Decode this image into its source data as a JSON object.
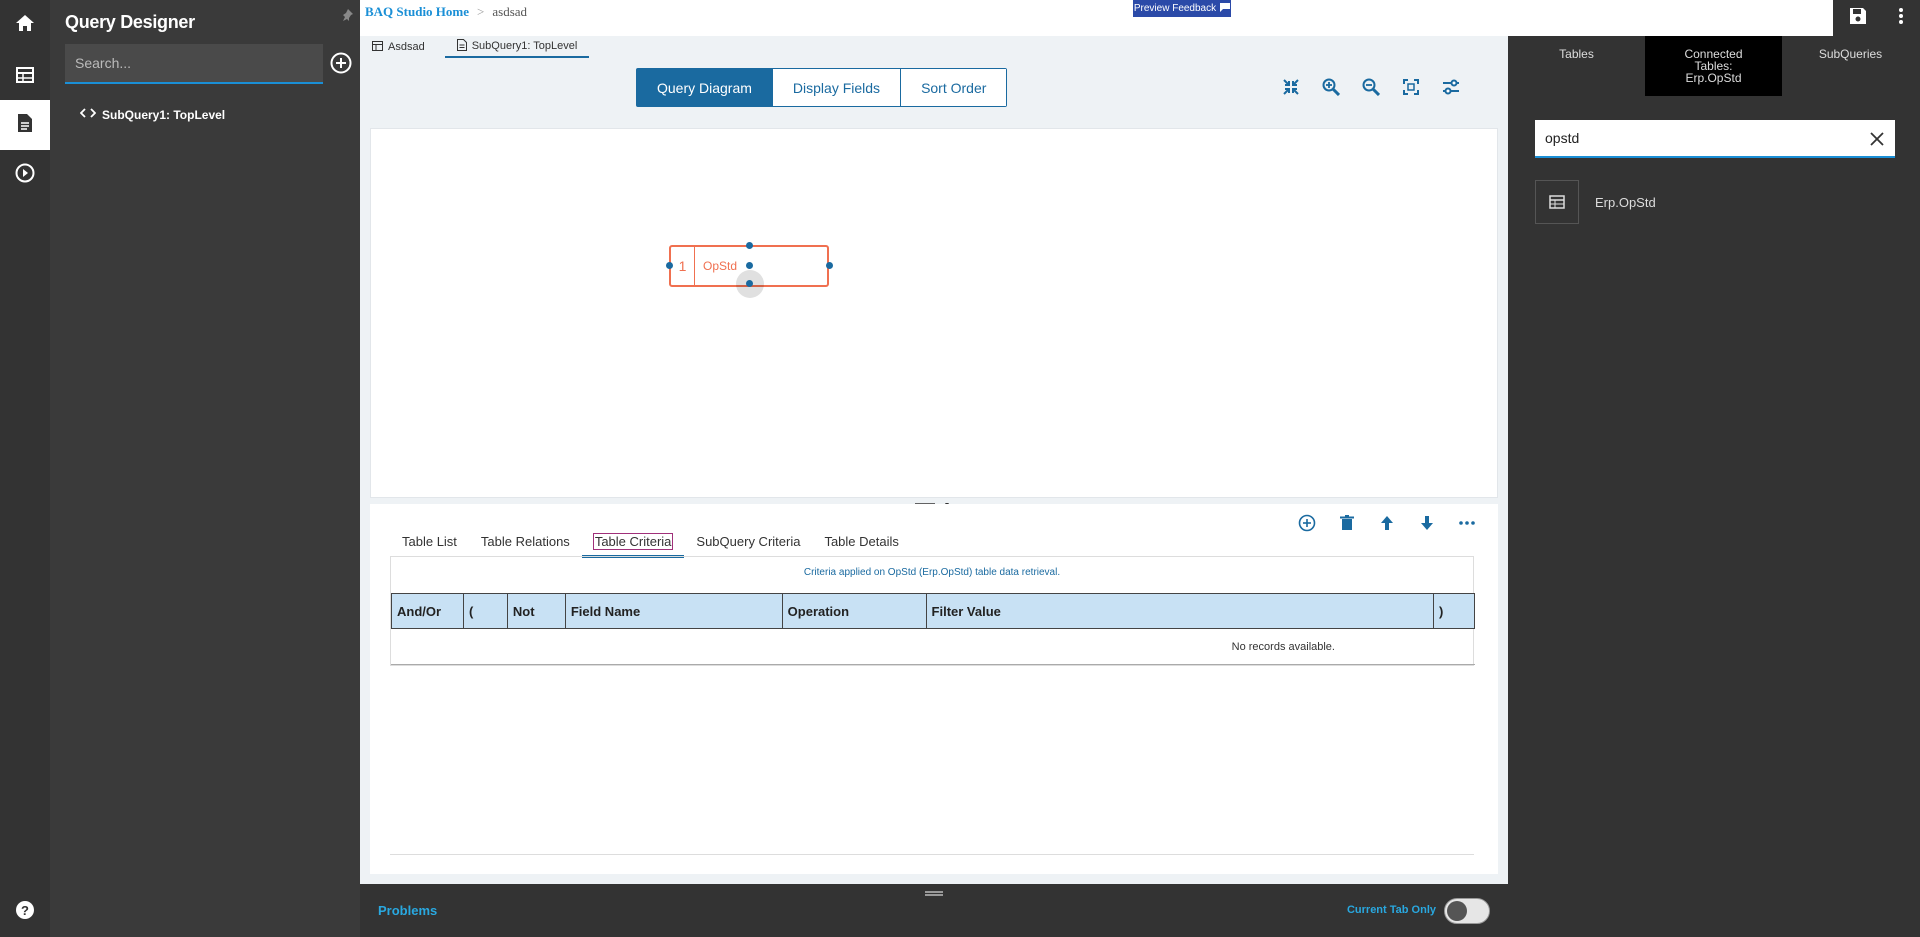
{
  "left_rail": {
    "items": [
      {
        "name": "home-icon"
      },
      {
        "name": "table-grid-icon"
      },
      {
        "name": "document-icon"
      },
      {
        "name": "play-circle-icon"
      }
    ],
    "help_icon": "help-circle-icon"
  },
  "query_designer": {
    "title": "Query Designer",
    "search_placeholder": "Search...",
    "tree": [
      {
        "label": "SubQuery1: TopLevel"
      }
    ]
  },
  "header": {
    "breadcrumb": {
      "home": "BAQ Studio Home",
      "separator": ">",
      "current": "asdsad"
    },
    "preview_feedback": "Preview Feedback"
  },
  "doc_tabs": [
    {
      "label": "Asdsad"
    },
    {
      "label": "SubQuery1: TopLevel"
    }
  ],
  "view_tabs": {
    "query_diagram": "Query Diagram",
    "display_fields": "Display Fields",
    "sort_order": "Sort Order"
  },
  "diagram": {
    "table_node": {
      "number": "1",
      "name": "OpStd"
    }
  },
  "bottom_tabs": {
    "table_list": "Table List",
    "table_relations": "Table Relations",
    "table_criteria": "Table Criteria",
    "subquery_criteria": "SubQuery Criteria",
    "table_details": "Table Details"
  },
  "criteria": {
    "note": "Criteria applied on OpStd (Erp.OpStd) table data retrieval.",
    "columns": [
      "And/Or",
      "(",
      "Not",
      "Field Name",
      "Operation",
      "Filter Value",
      ")"
    ],
    "empty": "No records available."
  },
  "problems": {
    "label": "Problems",
    "current_tab_only": "Current Tab Only"
  },
  "right_panel": {
    "tabs": {
      "tables": "Tables",
      "connected_line1": "Connected",
      "connected_line2": "Tables:",
      "connected_line3": "Erp.OpStd",
      "subqueries": "SubQueries"
    },
    "search_value": "opstd",
    "results": [
      {
        "label": "Erp.OpStd"
      }
    ]
  },
  "colors": {
    "accent": "#1a6aa0",
    "link": "#1a8fd6",
    "node": "#f07050",
    "dark": "#333333"
  }
}
